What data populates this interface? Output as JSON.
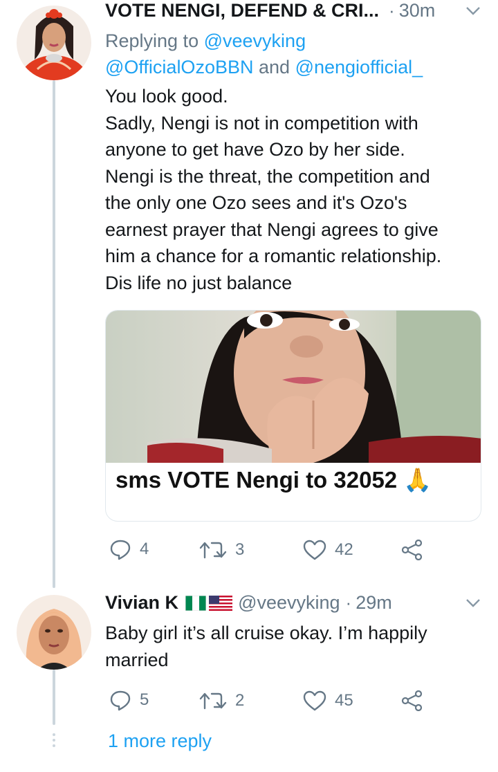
{
  "tweet1": {
    "author_name": "VOTE NENGI, DEFEND & CRI...",
    "separator": "·",
    "time": "30m",
    "replying_prefix": "Replying to",
    "mention1": "@veevyking",
    "mention2": "@OfficialOzoBBN",
    "mention_join": "and",
    "mention3": "@nengiofficial_",
    "body_lines": [
      "You look good.",
      "Sadly, Nengi is not in competition with",
      "anyone to get have Ozo by her side.",
      "Nengi is the threat, the competition and",
      "the only one Ozo sees and it's Ozo's",
      "earnest prayer that Nengi agrees to give",
      "him a chance for a romantic relationship.",
      "Dis life no just balance"
    ],
    "card_caption": "sms VOTE Nengi to 32052 🙏",
    "replies": "4",
    "retweets": "3",
    "likes": "42"
  },
  "tweet2": {
    "author_name": "Vivian K",
    "handle": "@veevyking",
    "separator": "·",
    "time": "29m",
    "body_lines": [
      "Baby girl it’s all cruise okay. I’m happily",
      "married"
    ],
    "replies": "5",
    "retweets": "2",
    "likes": "45"
  },
  "more_replies": "1 more reply",
  "colors": {
    "accent": "#1da1f2",
    "secondary_text": "#657786",
    "primary_text": "#14171a",
    "thread_line": "#ccd6dd"
  },
  "icons": [
    "reply-icon",
    "retweet-icon",
    "like-icon",
    "share-icon",
    "chevron-down-icon",
    "nigeria-flag-icon",
    "us-flag-icon"
  ]
}
